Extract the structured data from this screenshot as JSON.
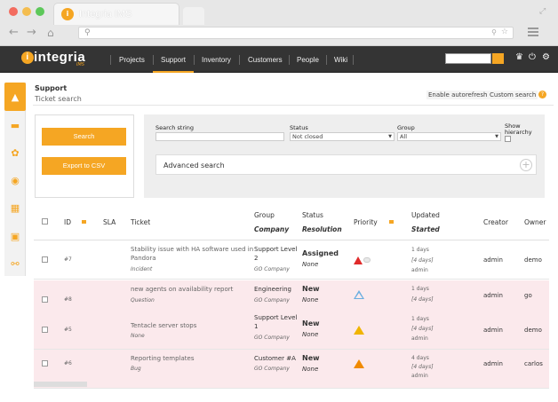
{
  "browser": {
    "tab_title": "Integria IMS",
    "tab_logo_letter": "i",
    "back_icon": "arrow-left-icon",
    "forward_icon": "arrow-right-icon",
    "home_icon": "home-icon",
    "search_icon": "search-icon"
  },
  "app": {
    "logo_text": "integria",
    "logo_sub": "IMS",
    "accent": "#f5a623",
    "nav": [
      "Projects",
      "Support",
      "Inventory",
      "Customers",
      "People",
      "Wiki"
    ],
    "active_nav": "Support"
  },
  "header": {
    "breadcrumb": "Support",
    "title": "Ticket search",
    "autorefresh": "Enable autorefresh",
    "custom_search": "Custom search",
    "help": "?"
  },
  "actions": {
    "search": "Search",
    "export": "Export to CSV"
  },
  "filters": {
    "search_string_label": "Search string",
    "search_string_value": "",
    "status_label": "Status",
    "status_value": "Not closed",
    "group_label": "Group",
    "group_value": "All",
    "hierarchy_label_1": "Show",
    "hierarchy_label_2": "hierarchy",
    "advanced": "Advanced search"
  },
  "table": {
    "headers": {
      "id": "ID",
      "sla": "SLA",
      "ticket": "Ticket",
      "group": "Group",
      "company": "Company",
      "status": "Status",
      "resolution": "Resolution",
      "priority": "Priority",
      "updated": "Updated",
      "started": "Started",
      "creator": "Creator",
      "owner": "Owner"
    },
    "rows": [
      {
        "id": "#7",
        "title_1": "Stability issue with HA software used in",
        "title_2": "Pandora",
        "type": "Incident",
        "group_1": "Support Level",
        "group_2": "2",
        "company": "GO Company",
        "status": "Assigned",
        "resolution": "None",
        "updated": "1 days",
        "started": "[4 days]",
        "by": "admin",
        "creator": "admin",
        "owner": "demo"
      },
      {
        "id": "#8",
        "title_1": "new agents on availability report",
        "title_2": "",
        "type": "Question",
        "group_1": "Engineering",
        "group_2": "",
        "company": "GO Company",
        "status": "New",
        "resolution": "None",
        "updated": "1 days",
        "started": "[4 days]",
        "by": "",
        "creator": "admin",
        "owner": "go"
      },
      {
        "id": "#5",
        "title_1": "Tentacle server stops",
        "title_2": "",
        "type": "None",
        "group_1": "Support Level",
        "group_2": "1",
        "company": "GO Company",
        "status": "New",
        "resolution": "None",
        "updated": "1 days",
        "started": "[4 days]",
        "by": "admin",
        "creator": "admin",
        "owner": "demo"
      },
      {
        "id": "#6",
        "title_1": "Reporting templates",
        "title_2": "",
        "type": "Bug",
        "group_1": "Customer #A",
        "group_2": "",
        "company": "GO Company",
        "status": "New",
        "resolution": "None",
        "updated": "4 days",
        "started": "[4 days]",
        "by": "admin",
        "creator": "admin",
        "owner": "carlos"
      }
    ]
  }
}
